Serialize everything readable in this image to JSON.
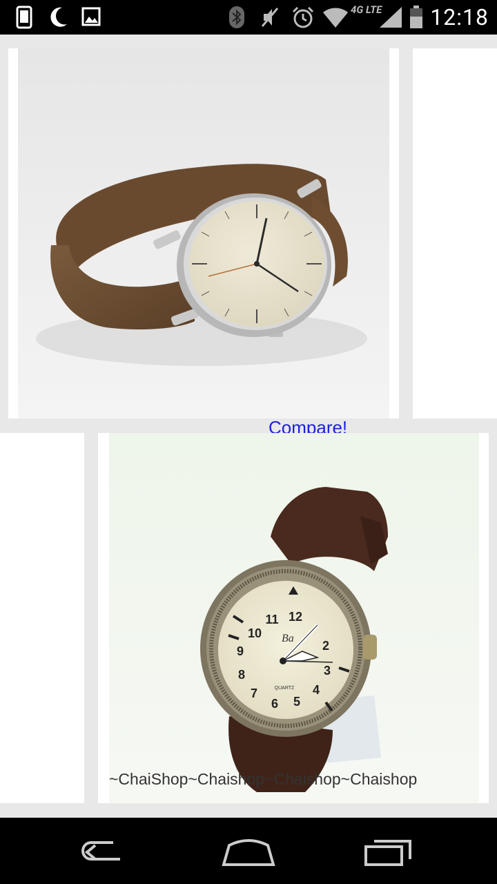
{
  "status_bar": {
    "time": "12:18",
    "network_label": "4G LTE",
    "icons": [
      "phone-icon",
      "moon-icon",
      "image-icon",
      "bluetooth-icon",
      "mute-icon",
      "alarm-icon",
      "wifi-icon",
      "signal-icon",
      "battery-icon"
    ]
  },
  "content": {
    "compare_label": "Compare!",
    "product_1": {
      "image": "minimalist-watch-brown-strap"
    },
    "product_2": {
      "image": "aviator-watch-brown-strap",
      "watermark": "~ChaiShop~Chaishop~Chaishop~Chaishop",
      "dial_numbers": [
        "12",
        "11",
        "10",
        "9",
        "8",
        "7",
        "6",
        "5",
        "4",
        "3",
        "2"
      ],
      "dial_text": "QUARTZ"
    }
  },
  "nav_bar": {
    "buttons": [
      "back-button",
      "home-button",
      "recents-button"
    ]
  }
}
